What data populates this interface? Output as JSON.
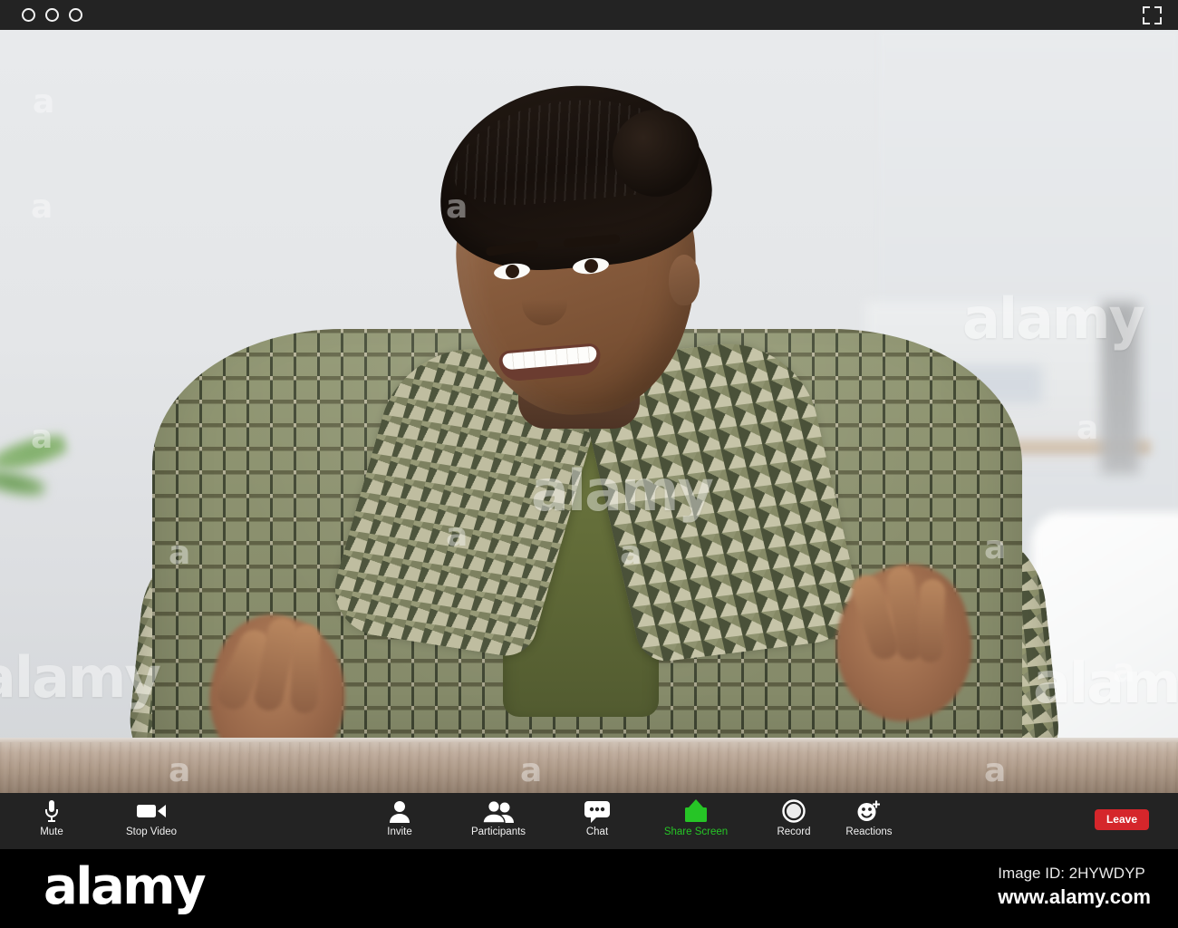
{
  "window": {
    "controls": [
      {
        "name": "close",
        "shape": "circle-outline"
      },
      {
        "name": "minimize",
        "shape": "circle-outline"
      },
      {
        "name": "zoom",
        "shape": "circle-outline"
      }
    ],
    "fullscreen_icon": "fullscreen-icon"
  },
  "video": {
    "subject_description": "Smiling woman in digital camouflage military uniform gesturing with both hands at a wooden desk",
    "background_description": "Blurred light grey office interior with shelf, white chair and green plant"
  },
  "toolbar": {
    "background_color": "#232323",
    "accent_color": "#26c526",
    "items": [
      {
        "label": "Mute",
        "icon": "microphone-icon",
        "accent": false
      },
      {
        "label": "Stop Video",
        "icon": "video-camera-icon",
        "accent": false
      },
      {
        "label": "Invite",
        "icon": "person-icon",
        "accent": false
      },
      {
        "label": "Participants",
        "icon": "people-icon",
        "accent": false
      },
      {
        "label": "Chat",
        "icon": "chat-bubble-icon",
        "accent": false
      },
      {
        "label": "Share Screen",
        "icon": "share-screen-icon",
        "accent": true
      },
      {
        "label": "Record",
        "icon": "record-circle-icon",
        "accent": false
      },
      {
        "label": "Reactions",
        "icon": "smiley-plus-icon",
        "accent": false
      }
    ],
    "leave": {
      "label": "Leave",
      "color": "#d5262b"
    }
  },
  "watermarks": {
    "word": "alamy",
    "letter": "a"
  },
  "footer": {
    "logo": "alamy",
    "image_id": "Image ID: 2HYWDYP",
    "url": "www.alamy.com"
  }
}
